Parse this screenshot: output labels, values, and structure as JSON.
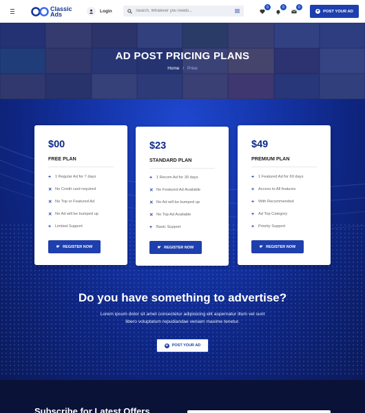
{
  "header": {
    "menu_icon": "hamburger-icon",
    "logo_line1": "Classic",
    "logo_line2": "Ads",
    "login_label": "Login",
    "search_placeholder": "Search, Whatever you needs...",
    "wishlist_count": "0",
    "notifications_count": "0",
    "messages_count": "0",
    "post_ad_label": "POST YOUR AD"
  },
  "hero": {
    "title": "AD POST PRICING PLANS",
    "breadcrumb_home": "Home",
    "breadcrumb_sep": "/",
    "breadcrumb_current": "Price"
  },
  "plans": [
    {
      "price": "$00",
      "name": "FREE PLAN",
      "features": [
        {
          "icon": "plus",
          "text": "1 Regular Ad for 7 days"
        },
        {
          "icon": "x",
          "text": "No Credit card required"
        },
        {
          "icon": "x",
          "text": "No Top or Featured Ad"
        },
        {
          "icon": "x",
          "text": "No Ad will be bumped up"
        },
        {
          "icon": "plus",
          "text": "Limited Support"
        }
      ],
      "button": "REGISTER NOW"
    },
    {
      "price": "$23",
      "name": "STANDARD PLAN",
      "features": [
        {
          "icon": "plus",
          "text": "1 Recom Ad for 30 days"
        },
        {
          "icon": "x",
          "text": "No Featured Ad Available"
        },
        {
          "icon": "x",
          "text": "No Ad will be bumped up"
        },
        {
          "icon": "x",
          "text": "No Top Ad Available"
        },
        {
          "icon": "plus",
          "text": "Basic Support"
        }
      ],
      "button": "REGISTER NOW"
    },
    {
      "price": "$49",
      "name": "PREMIUM PLAN",
      "features": [
        {
          "icon": "plus",
          "text": "1 Featured Ad for 60 days"
        },
        {
          "icon": "plus",
          "text": "Access to All features"
        },
        {
          "icon": "plus",
          "text": "With Recommended"
        },
        {
          "icon": "plus",
          "text": "Ad Top Category"
        },
        {
          "icon": "plus",
          "text": "Priority Support"
        }
      ],
      "button": "REGISTER NOW"
    }
  ],
  "cta": {
    "title": "Do you have something to advertise?",
    "text": "Lorem ipsum dolor sit amet consectetur adipisicing elit aspernatur illum vel sunt libero voluptatum repudiandae veniam maxime tenetur.",
    "button": "POST YOUR AD"
  },
  "subscribe": {
    "title": "Subscribe for Latest Offers"
  },
  "colors": {
    "brand": "#1e3fae",
    "price_text": "#0d2a8a"
  }
}
